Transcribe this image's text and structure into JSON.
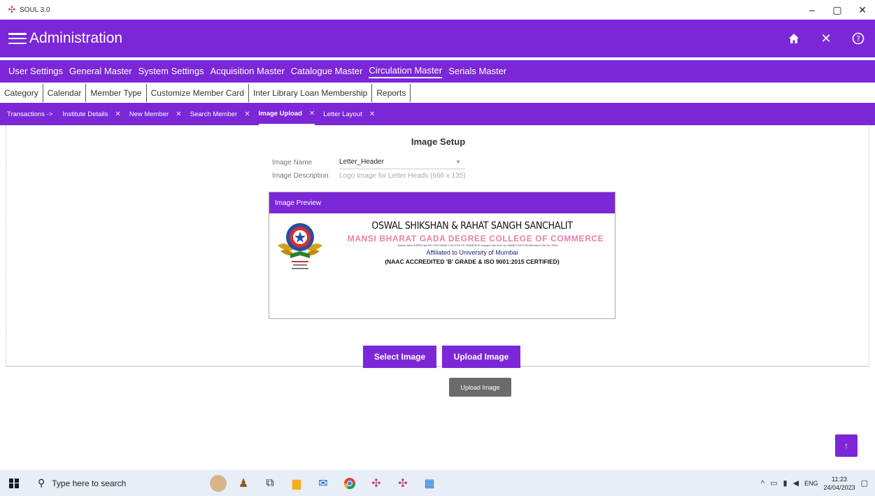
{
  "window": {
    "title": "SOUL 3.0",
    "minimize": "–",
    "maximize": "▢",
    "close": "✕"
  },
  "header": {
    "title": "Administration",
    "icons": [
      "home-icon",
      "close-icon",
      "help-icon"
    ]
  },
  "main_menu": [
    {
      "label": "User Settings"
    },
    {
      "label": "General Master"
    },
    {
      "label": "System Settings"
    },
    {
      "label": "Acquisition Master"
    },
    {
      "label": "Catalogue Master"
    },
    {
      "label": "Circulation Master",
      "active": true
    },
    {
      "label": "Serials Master"
    }
  ],
  "sub_menu": [
    {
      "label": "Category"
    },
    {
      "label": "Calendar"
    },
    {
      "label": "Member Type"
    },
    {
      "label": "Customize Member Card"
    },
    {
      "label": "Inter Library Loan Membership"
    },
    {
      "label": "Reports"
    }
  ],
  "breadcrumb": {
    "lead": "Transactions ->",
    "tabs": [
      {
        "label": "Institute Details"
      },
      {
        "label": "New Member"
      },
      {
        "label": "Search Member"
      },
      {
        "label": "Image Upload",
        "active": true
      },
      {
        "label": "Letter Layout"
      }
    ]
  },
  "setup": {
    "title": "Image Setup",
    "name_label": "Image Name",
    "name_value": "Letter_Header",
    "desc_label": "Image Description",
    "desc_value": "Logo Image for Letter Heads (666 x 135)",
    "preview_title": "Image Preview"
  },
  "letterhead": {
    "line1": "OSWAL SHIKSHAN & RAHAT SANGH SANCHALIT",
    "line2": "MANSI BHARAT GADA DEGREE COLLEGE OF COMMERCE",
    "line3": "(Earlier name SHREE HALARI VISA OSWAL COLLEGE OF COMMERCE changed vide Govt. No. NAMES 2019-20/1485 dated 10th Oct. 2020)",
    "line4": "Affiliated to University of Mumbai",
    "line5": "(NAAC ACCREDITED 'B' GRADE & ISO 9001:2015 CERTIFIED)"
  },
  "buttons": {
    "select": "Select Image",
    "upload": "Upload Image",
    "tooltip": "Upload Image",
    "scroll_top": "↑"
  },
  "taskbar": {
    "search_placeholder": "Type here to search",
    "lang": "ENG",
    "time": "11:23",
    "date": "24/04/2023"
  },
  "colors": {
    "brand_purple": "#7b27d8",
    "tooltip_gray": "#6b6b6b",
    "letterhead_pink": "#e87fa8"
  }
}
